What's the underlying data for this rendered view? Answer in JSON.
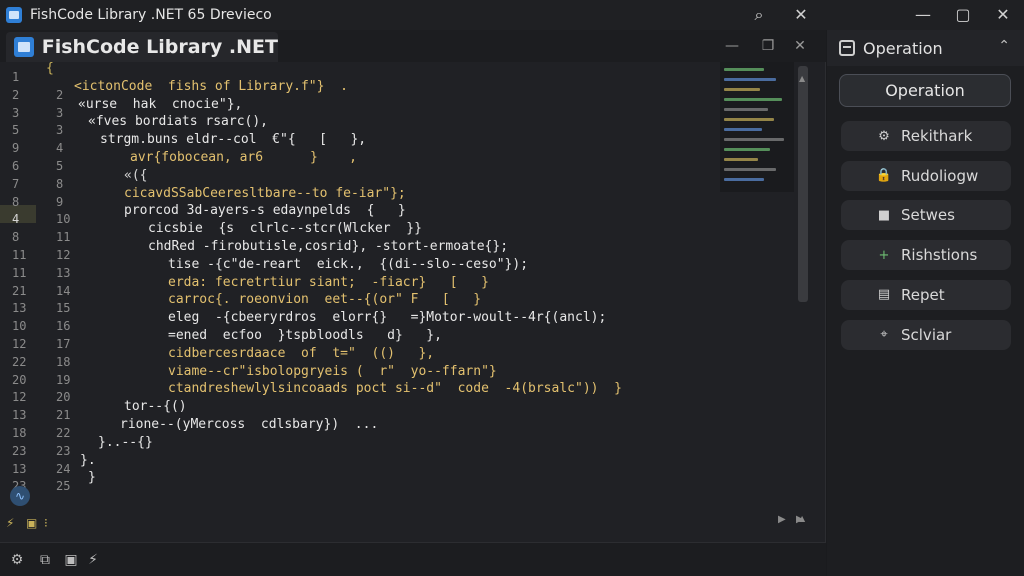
{
  "window": {
    "title": "FishCode Library .NET 65 Drevieco",
    "buttons": {
      "search": "⌕",
      "close": "✕",
      "minimize": "—",
      "maximize": "▢",
      "close2": "✕"
    }
  },
  "editor": {
    "tab_title": "FishCode Library .NET",
    "pane_buttons": {
      "minimize": "—",
      "restore": "❐",
      "close": "✕"
    },
    "line_numbers_outer": [
      "1",
      "2",
      "3",
      "5",
      "9",
      "6",
      "7",
      "8",
      "4",
      "8",
      "11",
      "11",
      "21",
      "13",
      "10",
      "12",
      "22",
      "20",
      "12",
      "13",
      "18",
      "23",
      "13",
      "23"
    ],
    "line_numbers_inner": [
      "",
      "2",
      "3",
      "3",
      "4",
      "5",
      "8",
      "9",
      "10",
      "11",
      "12",
      "13",
      "14",
      "15",
      "16",
      "17",
      "18",
      "19",
      "20",
      "21",
      "22",
      "23",
      "24",
      "25"
    ],
    "code_lines": [
      {
        "text": "{",
        "color": "#c9b25a"
      },
      {
        "text": "<ictonCode  fishs of Library.f\"}  .",
        "color": "#e3c16f"
      },
      {
        "text": "«urse  hak  cnocie\"},",
        "color": "#e8e8e8"
      },
      {
        "text": "«fves bordiats rsarc(),",
        "color": "#e8e8e8"
      },
      {
        "text": "strgm.buns eldr--col  €\"{   [   },",
        "color": "#e8e8e8"
      },
      {
        "text": "avr{fobocean, ar6      }    ,",
        "color": "#e3c16f"
      },
      {
        "text": "«({",
        "color": "#d6d6d6"
      },
      {
        "text": "cicavdSSabCeeresltbare--to fe-iar\"};",
        "color": "#e3c16f"
      },
      {
        "text": "prorcod 3d-ayers-s edaynpelds  {   }",
        "color": "#e8e8e8"
      },
      {
        "text": "cicsbie  {s  clrlc--stcr(Wlcker  }}",
        "color": "#e8e8e8"
      },
      {
        "text": "chdRed -firobutisle,cosrid}, -stort-ermoate{};",
        "color": "#e8e8e8"
      },
      {
        "text": "tise -{c\"de-reart  eick.,  {(di--slo--ceso\"});",
        "color": "#e8e8e8"
      },
      {
        "text": "erda: fecretrtiur siant;  -fiacr}   [   }",
        "color": "#e3c16f"
      },
      {
        "text": "carroc{. roeonvion  eet--{(or\" F   [   }",
        "color": "#e3c16f"
      },
      {
        "text": "eleg  -{cbeeryrdros  elorr{}   =}Motor-woult--4r{(ancl);",
        "color": "#e8e8e8"
      },
      {
        "text": "=ened  ecfoo  }tspbloodls   d}   },",
        "color": "#e8e8e8"
      },
      {
        "text": "cidbercesrdaace  of  t=\"  (()   },",
        "color": "#e3c16f"
      },
      {
        "text": "viame--cr\"isbolopgryeis (  r\"  yo--ffarn\"}",
        "color": "#e3c16f"
      },
      {
        "text": "ctandreshewlylsincoaads poct si--d\"  code  -4(brsalc\"))  }",
        "color": "#e3c16f"
      },
      {
        "text": "tor--{()",
        "color": "#e8e8e8"
      },
      {
        "text": "rione--(yMercoss  cdlsbary})  ...",
        "color": "#e8e8e8"
      },
      {
        "text": "}..--{}",
        "color": "#e8e8e8"
      },
      {
        "text": "}.",
        "color": "#e8e8e8"
      },
      {
        "text": "}",
        "color": "#e8e8e8"
      }
    ],
    "footer_icons": [
      "⚡",
      "▣",
      "⁝"
    ]
  },
  "statusbar": {
    "icons": [
      "⚙",
      "⧉",
      "▣",
      "⚡"
    ]
  },
  "panel": {
    "header_label": "Operation",
    "collapse_icon": "⌃",
    "primary_button": "Operation",
    "buttons": [
      {
        "label": "Rekithark",
        "icon": "⚙",
        "icon_name": "gear-icon"
      },
      {
        "label": "Rudoliogw",
        "icon": "🔒",
        "icon_name": "lock-icon"
      },
      {
        "label": "Setwes",
        "icon": "■",
        "icon_name": "square-icon"
      },
      {
        "label": "Rishstions",
        "icon": "+",
        "icon_name": "plus-icon"
      },
      {
        "label": "Repet",
        "icon": "▤",
        "icon_name": "report-icon"
      },
      {
        "label": "Sclviar",
        "icon": "⌖",
        "icon_name": "location-icon"
      }
    ],
    "accent": "#6fbf73"
  }
}
